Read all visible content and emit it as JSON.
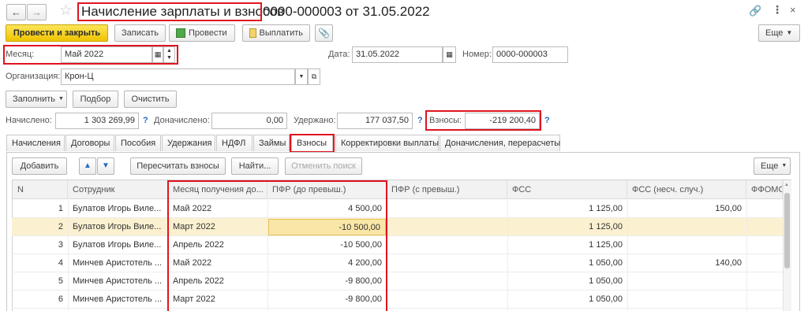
{
  "window": {
    "title": "Начисление зарплаты и взносов",
    "doc_ref": "0000-000003 от 31.05.2022"
  },
  "toolbar": {
    "post_close": "Провести и закрыть",
    "save": "Записать",
    "post": "Провести",
    "pay": "Выплатить",
    "more": "Еще"
  },
  "header": {
    "month_label": "Месяц:",
    "month_value": "Май 2022",
    "date_label": "Дата:",
    "date_value": "31.05.2022",
    "number_label": "Номер:",
    "number_value": "0000-000003",
    "org_label": "Организация:",
    "org_value": "Крон-Ц",
    "fill": "Заполнить",
    "select": "Подбор",
    "clear": "Очистить"
  },
  "totals": {
    "accrued_label": "Начислено:",
    "accrued_value": "1 303 269,99",
    "add_label": "Доначислено:",
    "add_value": "0,00",
    "withheld_label": "Удержано:",
    "withheld_value": "177 037,50",
    "contrib_label": "Взносы:",
    "contrib_value": "-219 200,40",
    "q": "?"
  },
  "tabs": [
    "Начисления",
    "Договоры",
    "Пособия",
    "Удержания",
    "НДФЛ",
    "Займы",
    "Взносы",
    "Корректировки выплаты",
    "Доначисления, перерасчеты"
  ],
  "table_toolbar": {
    "add": "Добавить",
    "recalc": "Пересчитать взносы",
    "find": "Найти...",
    "cancel_search": "Отменить поиск",
    "more": "Еще"
  },
  "table": {
    "columns": [
      "N",
      "Сотрудник",
      "Месяц получения до...",
      "ПФР (до превыш.)",
      "ПФР (с превыш.)",
      "ФСС",
      "ФСС (несч. случ.)",
      "ФФОМС"
    ],
    "rows": [
      {
        "n": "1",
        "emp": "Булатов Игорь Виле...",
        "month": "Май 2022",
        "pfr": "4 500,00",
        "pfr2": "",
        "fss": "1 125,00",
        "fss_ns": "150,00"
      },
      {
        "n": "2",
        "emp": "Булатов Игорь Виле...",
        "month": "Март 2022",
        "pfr": "-10 500,00",
        "pfr2": "",
        "fss": "1 125,00",
        "fss_ns": ""
      },
      {
        "n": "3",
        "emp": "Булатов Игорь Виле...",
        "month": "Апрель 2022",
        "pfr": "-10 500,00",
        "pfr2": "",
        "fss": "1 125,00",
        "fss_ns": ""
      },
      {
        "n": "4",
        "emp": "Минчев Аристотель ...",
        "month": "Май 2022",
        "pfr": "4 200,00",
        "pfr2": "",
        "fss": "1 050,00",
        "fss_ns": "140,00"
      },
      {
        "n": "5",
        "emp": "Минчев Аристотель ...",
        "month": "Апрель 2022",
        "pfr": "-9 800,00",
        "pfr2": "",
        "fss": "1 050,00",
        "fss_ns": ""
      },
      {
        "n": "6",
        "emp": "Минчев Аристотель ...",
        "month": "Март 2022",
        "pfr": "-9 800,00",
        "pfr2": "",
        "fss": "1 050,00",
        "fss_ns": ""
      }
    ]
  },
  "colors": {
    "primary_btn": "#f0c300",
    "highlight": "#e0141e",
    "selected_row": "#fbf1d1",
    "link": "#2a6cc0"
  },
  "icons": [
    "back-icon",
    "forward-icon",
    "star-icon",
    "link-icon",
    "more-vert-icon",
    "close-icon",
    "calendar-icon",
    "stepper-icon",
    "dropdown-icon",
    "open-icon",
    "post-doc-icon",
    "pay-doc-icon",
    "attach-icon",
    "up-arrow-icon",
    "down-arrow-icon"
  ]
}
